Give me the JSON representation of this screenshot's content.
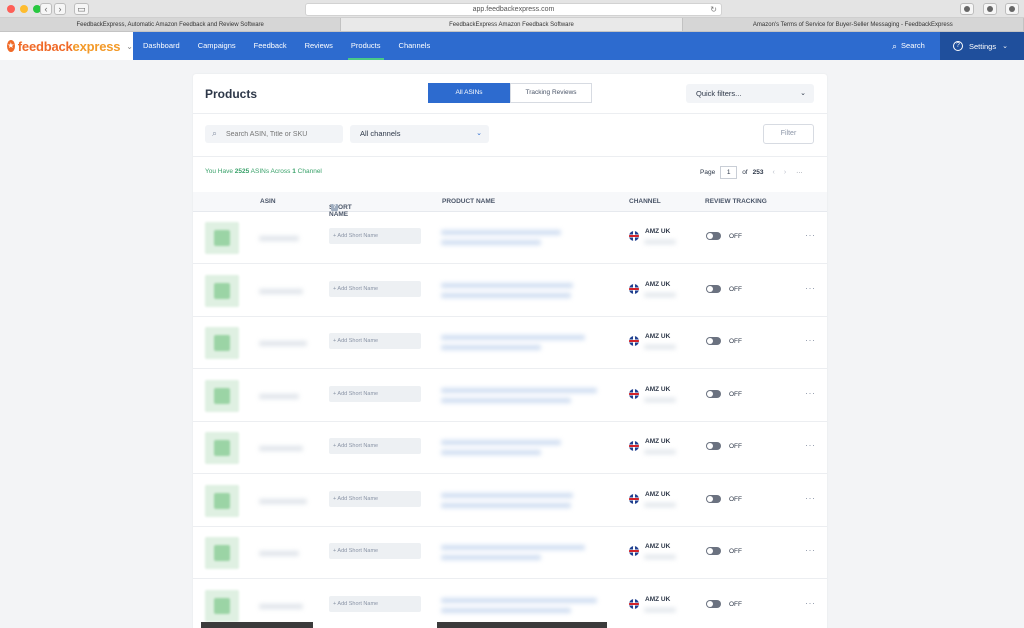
{
  "browser": {
    "url": "app.feedbackexpress.com",
    "tabs": [
      "FeedbackExpress, Automatic Amazon Feedback and Review Software",
      "FeedbackExpress Amazon Feedback Software",
      "Amazon's Terms of Service for Buyer-Seller Messaging - FeedbackExpress"
    ]
  },
  "nav": {
    "logo_part1": "feedback",
    "logo_part2": "express",
    "links": [
      "Dashboard",
      "Campaigns",
      "Feedback",
      "Reviews",
      "Products",
      "Channels"
    ],
    "active": "Products",
    "search_label": "Search",
    "settings_label": "Settings"
  },
  "products": {
    "title": "Products",
    "tab_all": "All ASINs",
    "tab_tracking": "Tracking Reviews",
    "quick_filters": "Quick filters...",
    "search_placeholder": "Search ASIN, Title or SKU",
    "channels_select": "All channels",
    "filter_button": "Filter",
    "summary_prefix": "You Have ",
    "summary_count": "2525",
    "summary_mid": " ASINs Across ",
    "summary_channels": "1",
    "summary_suffix": " Channel",
    "pager_label": "Page",
    "pager_current": "1",
    "pager_of": "of",
    "pager_total": "253"
  },
  "table": {
    "headers": {
      "asin": "ASIN",
      "short_name": "SHORT NAME",
      "product_name": "PRODUCT NAME",
      "channel": "CHANNEL",
      "review_tracking": "REVIEW TRACKING"
    },
    "rows": [
      {
        "short_name_placeholder": "+ Add Short Name",
        "channel": "AMZ UK",
        "tracking": "OFF"
      },
      {
        "short_name_placeholder": "+ Add Short Name",
        "channel": "AMZ UK",
        "tracking": "OFF"
      },
      {
        "short_name_placeholder": "+ Add Short Name",
        "channel": "AMZ UK",
        "tracking": "OFF"
      },
      {
        "short_name_placeholder": "+ Add Short Name",
        "channel": "AMZ UK",
        "tracking": "OFF"
      },
      {
        "short_name_placeholder": "+ Add Short Name",
        "channel": "AMZ UK",
        "tracking": "OFF"
      },
      {
        "short_name_placeholder": "+ Add Short Name",
        "channel": "AMZ UK",
        "tracking": "OFF"
      },
      {
        "short_name_placeholder": "+ Add Short Name",
        "channel": "AMZ UK",
        "tracking": "OFF"
      },
      {
        "short_name_placeholder": "+ Add Short Name",
        "channel": "AMZ UK",
        "tracking": "OFF"
      }
    ]
  },
  "colors": {
    "brand_blue": "#2d6bcf",
    "settings_blue": "#1f4f9c",
    "brand_orange": "#f06a28",
    "accent_green": "#38a169"
  }
}
